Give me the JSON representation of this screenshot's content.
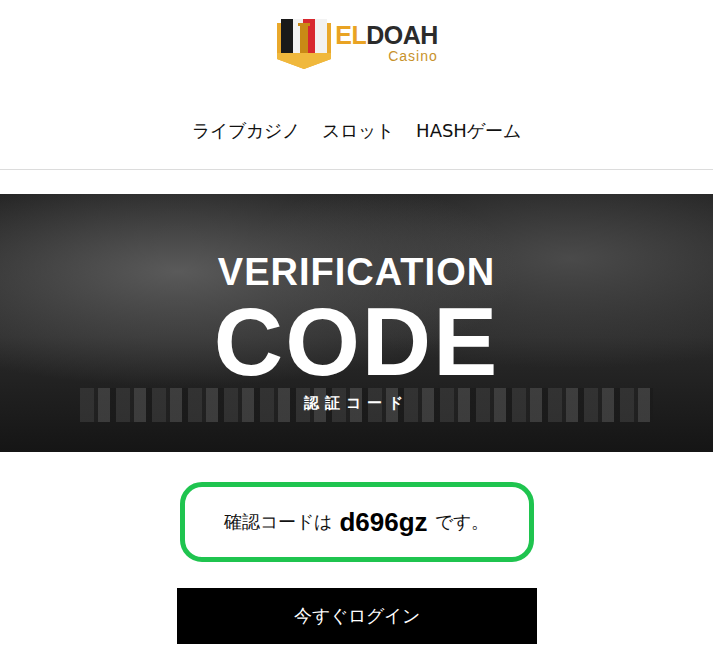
{
  "logo": {
    "accent": "EL",
    "name": "DOAH",
    "sub": "Casino"
  },
  "nav": [
    {
      "label": "ライブカジノ"
    },
    {
      "label": "スロット"
    },
    {
      "label": "HASHゲーム"
    }
  ],
  "banner": {
    "title": "VERIFICATION",
    "headline": "CODE",
    "subtitle": "認証コード"
  },
  "message": {
    "before": "確認コードは",
    "code": "d696gz",
    "after": "です。"
  },
  "button": "今すぐログイン"
}
